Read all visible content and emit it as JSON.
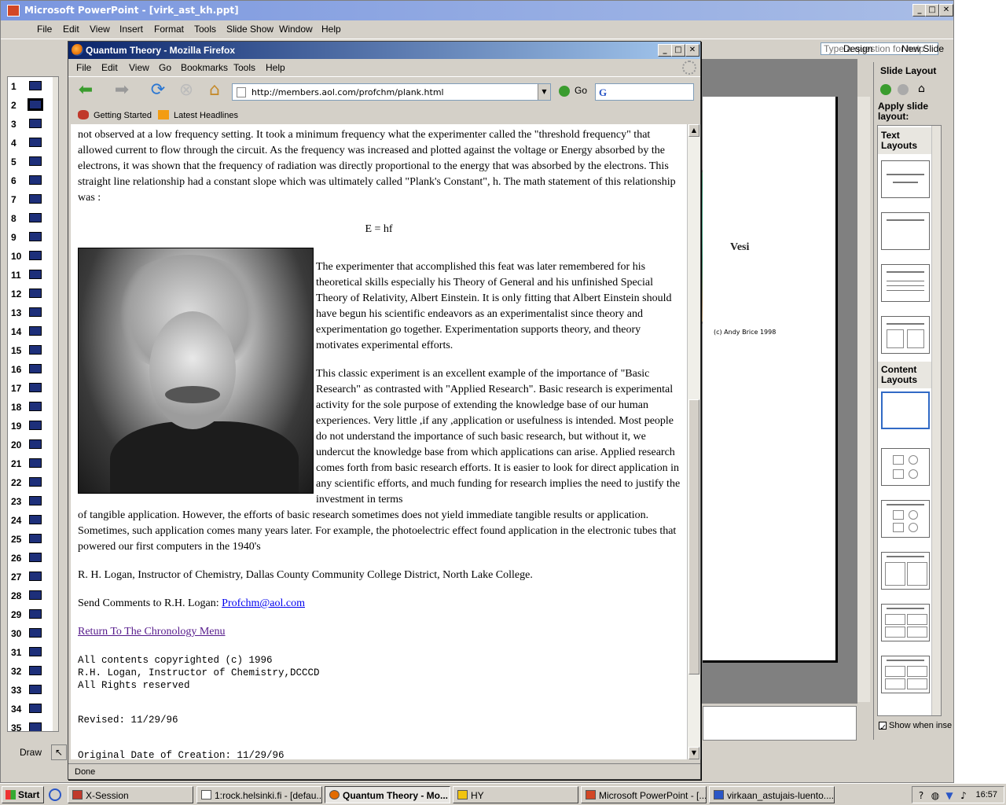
{
  "powerpoint": {
    "title": "Microsoft PowerPoint - [virk_ast_kh.ppt]",
    "menu": [
      "File",
      "Edit",
      "View",
      "Insert",
      "Format",
      "Tools",
      "Slide Show",
      "Window",
      "Help"
    ],
    "help_placeholder": "Type a question for help",
    "toolbar": {
      "design": "Design",
      "new_slide": "New Slide"
    },
    "slide_numbers": [
      "1",
      "2",
      "3",
      "4",
      "5",
      "6",
      "7",
      "8",
      "9",
      "10",
      "11",
      "12",
      "13",
      "14",
      "15",
      "16",
      "17",
      "18",
      "19",
      "20",
      "21",
      "22",
      "23",
      "24",
      "25",
      "26",
      "27",
      "28",
      "29",
      "30",
      "31",
      "32",
      "33",
      "34",
      "35"
    ],
    "slide_image_label": "Vesi",
    "slide_image_credit": "(c) Andy Brice 1998",
    "task_pane": {
      "title": "Slide Layout",
      "apply_label": "Apply slide layout:",
      "text_layouts": "Text Layouts",
      "content_layouts": "Content Layouts",
      "show_when_inserting": "Show when inse"
    },
    "draw_label": "Draw"
  },
  "firefox": {
    "title": "Quantum Theory - Mozilla Firefox",
    "menu": [
      "File",
      "Edit",
      "View",
      "Go",
      "Bookmarks",
      "Tools",
      "Help"
    ],
    "url": "http://members.aol.com/profchm/plank.html",
    "go_label": "Go",
    "bookmarks": [
      "Getting Started",
      "Latest Headlines"
    ],
    "status": "Done"
  },
  "page": {
    "para1": "not observed at a low frequency setting. It took a minimum frequency what the experimenter called the \"threshold frequency\" that allowed current to flow through the circuit. As the frequency was increased and plotted against the voltage or Energy absorbed by the electrons, it was shown that the frequency of radiation was directly proportional to the energy that was absorbed by the electrons. This straight line relationship had a constant slope which was ultimately called \"Plank's Constant\", h. The math statement of this relationship was :",
    "formula": "E = hf",
    "para2": "The experimenter that accomplished this feat was later remembered for his theoretical skills especially his Theory of General and his unfinished Special Theory of Relativity, Albert Einstein. It is only fitting that Albert Einstein should have begun his scientific endeavors as an experimentalist since theory and experimentation go together. Experimentation supports theory, and theory motivates experimental efforts.",
    "para3_wrap": "This classic experiment is an excellent example of the importance of \"Basic Research\" as contrasted with \"Applied Research\". Basic research is experimental activity for the sole purpose of extending the knowledge base of our human experiences. Very little ,if any ,application or usefulness is intended. Most people do not understand the importance of such basic research, but without it, we undercut the knowledge base from which applications can arise. Applied research comes forth from basic research efforts. It is easier to look for direct application in any scientific efforts, and much funding for research implies the need to justify the investment in terms",
    "para3_rest": "of tangible application. However, the efforts of basic research sometimes does not yield immediate tangible results or application. Sometimes, such application comes many years later. For example, the photoelectric effect found application in the electronic tubes that powered our first computers in the 1940's",
    "author": "R. H. Logan, Instructor of Chemistry, Dallas County Community College District, North Lake College.",
    "comments_prefix": "Send Comments to R.H. Logan: ",
    "email": "Profchm@aol.com",
    "chronology_link": "Return To The Chronology Menu",
    "copyright": "All contents copyrighted (c) 1996\nR.H. Logan, Instructor of Chemistry,DCCCD\nAll Rights reserved",
    "revised": "Revised: 11/29/96",
    "original_date": "Original Date of Creation: 11/29/96"
  },
  "taskbar": {
    "start": "Start",
    "items": [
      "X-Session",
      "1:rock.helsinki.fi - [defau...",
      "Quantum Theory - Mo...",
      "HY",
      "Microsoft PowerPoint - [...",
      "virkaan_astujais-luento...."
    ],
    "clock": "16:57"
  }
}
